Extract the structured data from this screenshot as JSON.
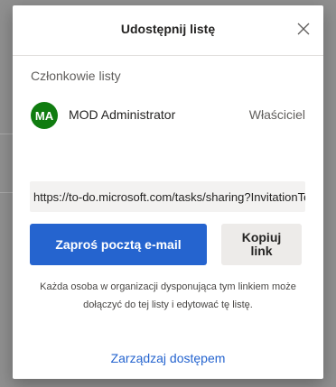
{
  "dialog": {
    "title": "Udostępnij listę",
    "close_icon": "close-icon"
  },
  "members": {
    "label": "Członkowie listy",
    "items": [
      {
        "initials": "MA",
        "name": "MOD Administrator",
        "role": "Właściciel",
        "avatar_color": "#107c10"
      }
    ]
  },
  "share": {
    "link_value": "https://to-do.microsoft.com/tasks/sharing?InvitationToken=",
    "invite_email_label": "Zaproś pocztą e-mail",
    "copy_link_label": "Kopiuj link",
    "note": "Każda osoba w organizacji dysponująca tym linkiem może dołączyć do tej listy i edytować tę listę.",
    "manage_access_label": "Zarządzaj dostępem"
  },
  "colors": {
    "accent": "#2564cf",
    "avatar": "#107c10"
  }
}
